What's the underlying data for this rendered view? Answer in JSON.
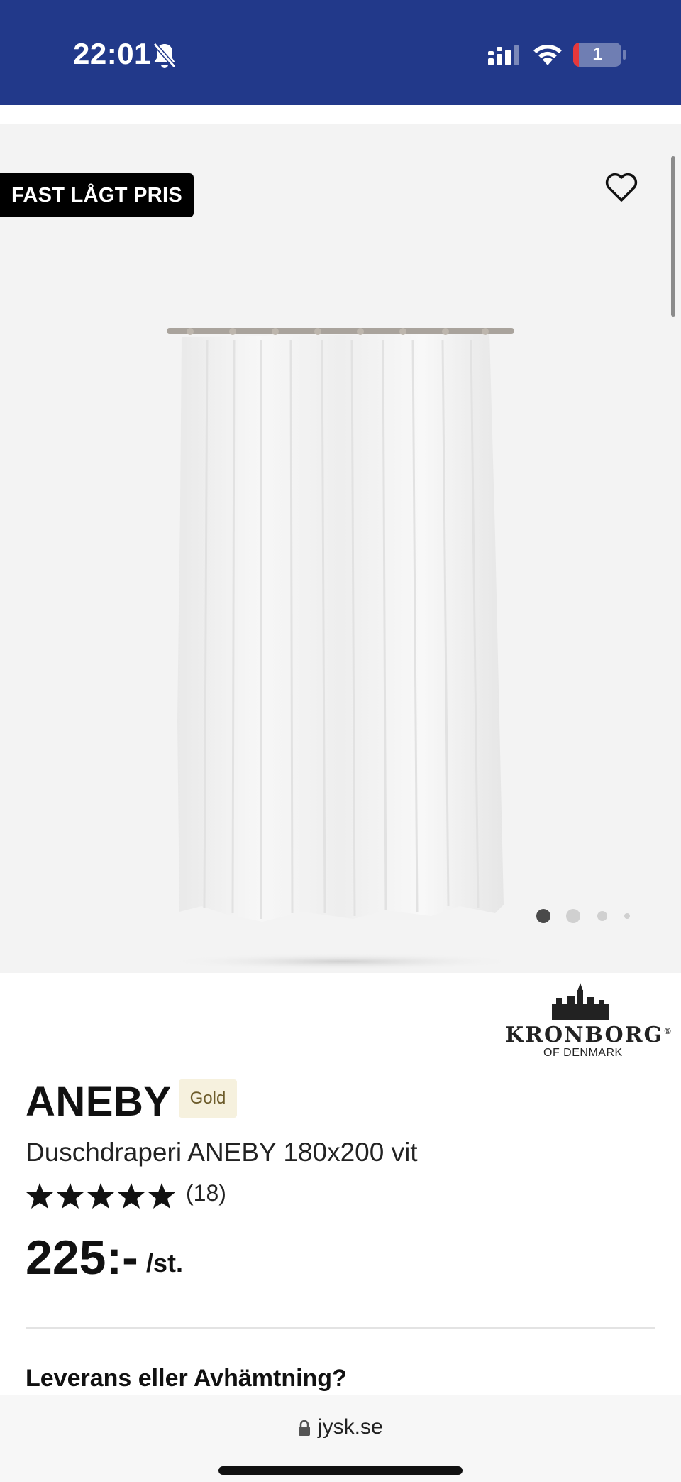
{
  "status_bar": {
    "time": "22:01",
    "battery_level": "1",
    "bg_color": "#22398a"
  },
  "gallery": {
    "badge": "FAST LÅGT PRIS",
    "favorite_icon": "heart-icon",
    "image_icon": "shower-curtain-image",
    "slide_count": 4,
    "active_slide": 1
  },
  "brand": {
    "name": "KRONBORG",
    "registered": "®",
    "sub": "OF DENMARK"
  },
  "product": {
    "title": "ANEBY",
    "tier_badge": "Gold",
    "subtitle": "Duschdraperi ANEBY 180x200 vit",
    "rating": 5,
    "review_count": "(18)",
    "price": "225:-",
    "price_unit": "/st."
  },
  "delivery": {
    "heading": "Leverans eller Avhämtning?"
  },
  "browser": {
    "url": "jysk.se",
    "lock_icon": "lock-icon"
  }
}
